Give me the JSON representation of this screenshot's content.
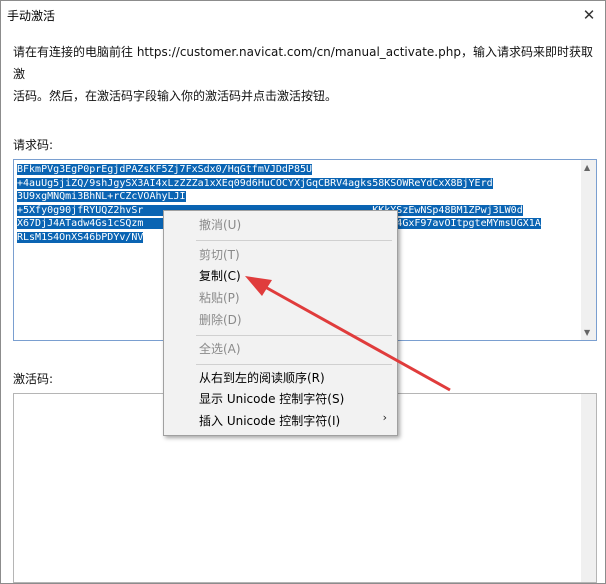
{
  "window": {
    "title": "手动激活",
    "close_glyph": "✕"
  },
  "instruction": {
    "line1": "请在有连接的电脑前往 https://customer.navicat.com/cn/manual_activate.php，输入请求码来即时获取激",
    "line2": "活码。然后，在激活码字段输入你的激活码并点击激活按钮。"
  },
  "request_code": {
    "label": "请求码:",
    "lines": [
      "BFkmPVg3EgP0prEgjdPAZsKF5Zj7FxSdx0/HqGtfmVJDdP85U",
      "+4auUg5jiZQ/9shJgySX3AI4xLzZZZa1xXEq09d6HuCOCYXjGqCBRV4agks58KSOWReYdCxX8BjYErd",
      "3U9xgMNQmi3BhNL+rCZcVOAhyLJI",
      "+5Xfy0g90jfRYUQZ2hvSr                                      KKkYSzEwNSp48BM1ZPwj3LW0d",
      "X67DjJ4ATadw4Gs1cSQzm                                         d4GxF97avOItpgteMYmsUGX1A",
      "RLsM1S4OnXS46bPDYv/NV"
    ]
  },
  "activation_code": {
    "label": "激活码:",
    "value": ""
  },
  "context_menu": {
    "items": [
      {
        "label": "撤消(U)",
        "enabled": false
      },
      {
        "label": "剪切(T)",
        "enabled": false
      },
      {
        "label": "复制(C)",
        "enabled": true
      },
      {
        "label": "粘贴(P)",
        "enabled": false
      },
      {
        "label": "删除(D)",
        "enabled": false
      },
      {
        "label": "全选(A)",
        "enabled": false
      },
      {
        "label": "从右到左的阅读顺序(R)",
        "enabled": true
      },
      {
        "label": "显示 Unicode 控制字符(S)",
        "enabled": true
      },
      {
        "label": "插入 Unicode 控制字符(I)",
        "enabled": true
      }
    ],
    "submenu_glyph": "›"
  },
  "colors": {
    "selection": "#0a64b3",
    "annotation_arrow": "#e03c3c"
  }
}
